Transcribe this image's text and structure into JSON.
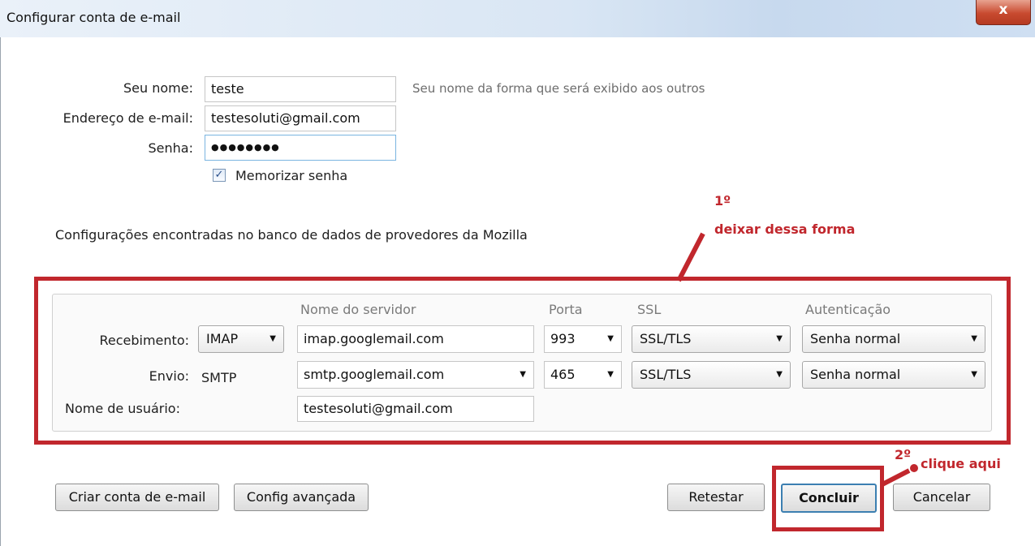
{
  "window": {
    "title": "Configurar conta de e-mail",
    "close_label": "x"
  },
  "form": {
    "name_label": "Seu nome:",
    "name_value": "teste",
    "name_hint": "Seu nome da forma que será exibido aos outros",
    "email_label": "Endereço de e-mail:",
    "email_value": "testesoluti@gmail.com",
    "password_label": "Senha:",
    "password_value": "●●●●●●●●",
    "remember_label": "Memorizar senha",
    "remember_checked": true
  },
  "found_text": "Configurações encontradas no banco de dados de provedores da Mozilla",
  "servers": {
    "headers": {
      "server": "Nome do servidor",
      "port": "Porta",
      "ssl": "SSL",
      "auth": "Autenticação"
    },
    "incoming": {
      "label": "Recebimento:",
      "protocol": "IMAP",
      "server": "imap.googlemail.com",
      "port": "993",
      "ssl": "SSL/TLS",
      "auth": "Senha normal"
    },
    "outgoing": {
      "label": "Envio:",
      "protocol": "SMTP",
      "server": "smtp.googlemail.com",
      "port": "465",
      "ssl": "SSL/TLS",
      "auth": "Senha normal"
    },
    "username_label": "Nome de usuário:",
    "username_value": "testesoluti@gmail.com"
  },
  "buttons": {
    "create": "Criar conta de e-mail",
    "advanced": "Config avançada",
    "retest": "Retestar",
    "done": "Concluir",
    "cancel": "Cancelar"
  },
  "annotations": {
    "step1_number": "1º",
    "step1_text": "deixar dessa forma",
    "step2_number": "2º",
    "step2_text": "clique aqui",
    "color": "#c1272d"
  }
}
